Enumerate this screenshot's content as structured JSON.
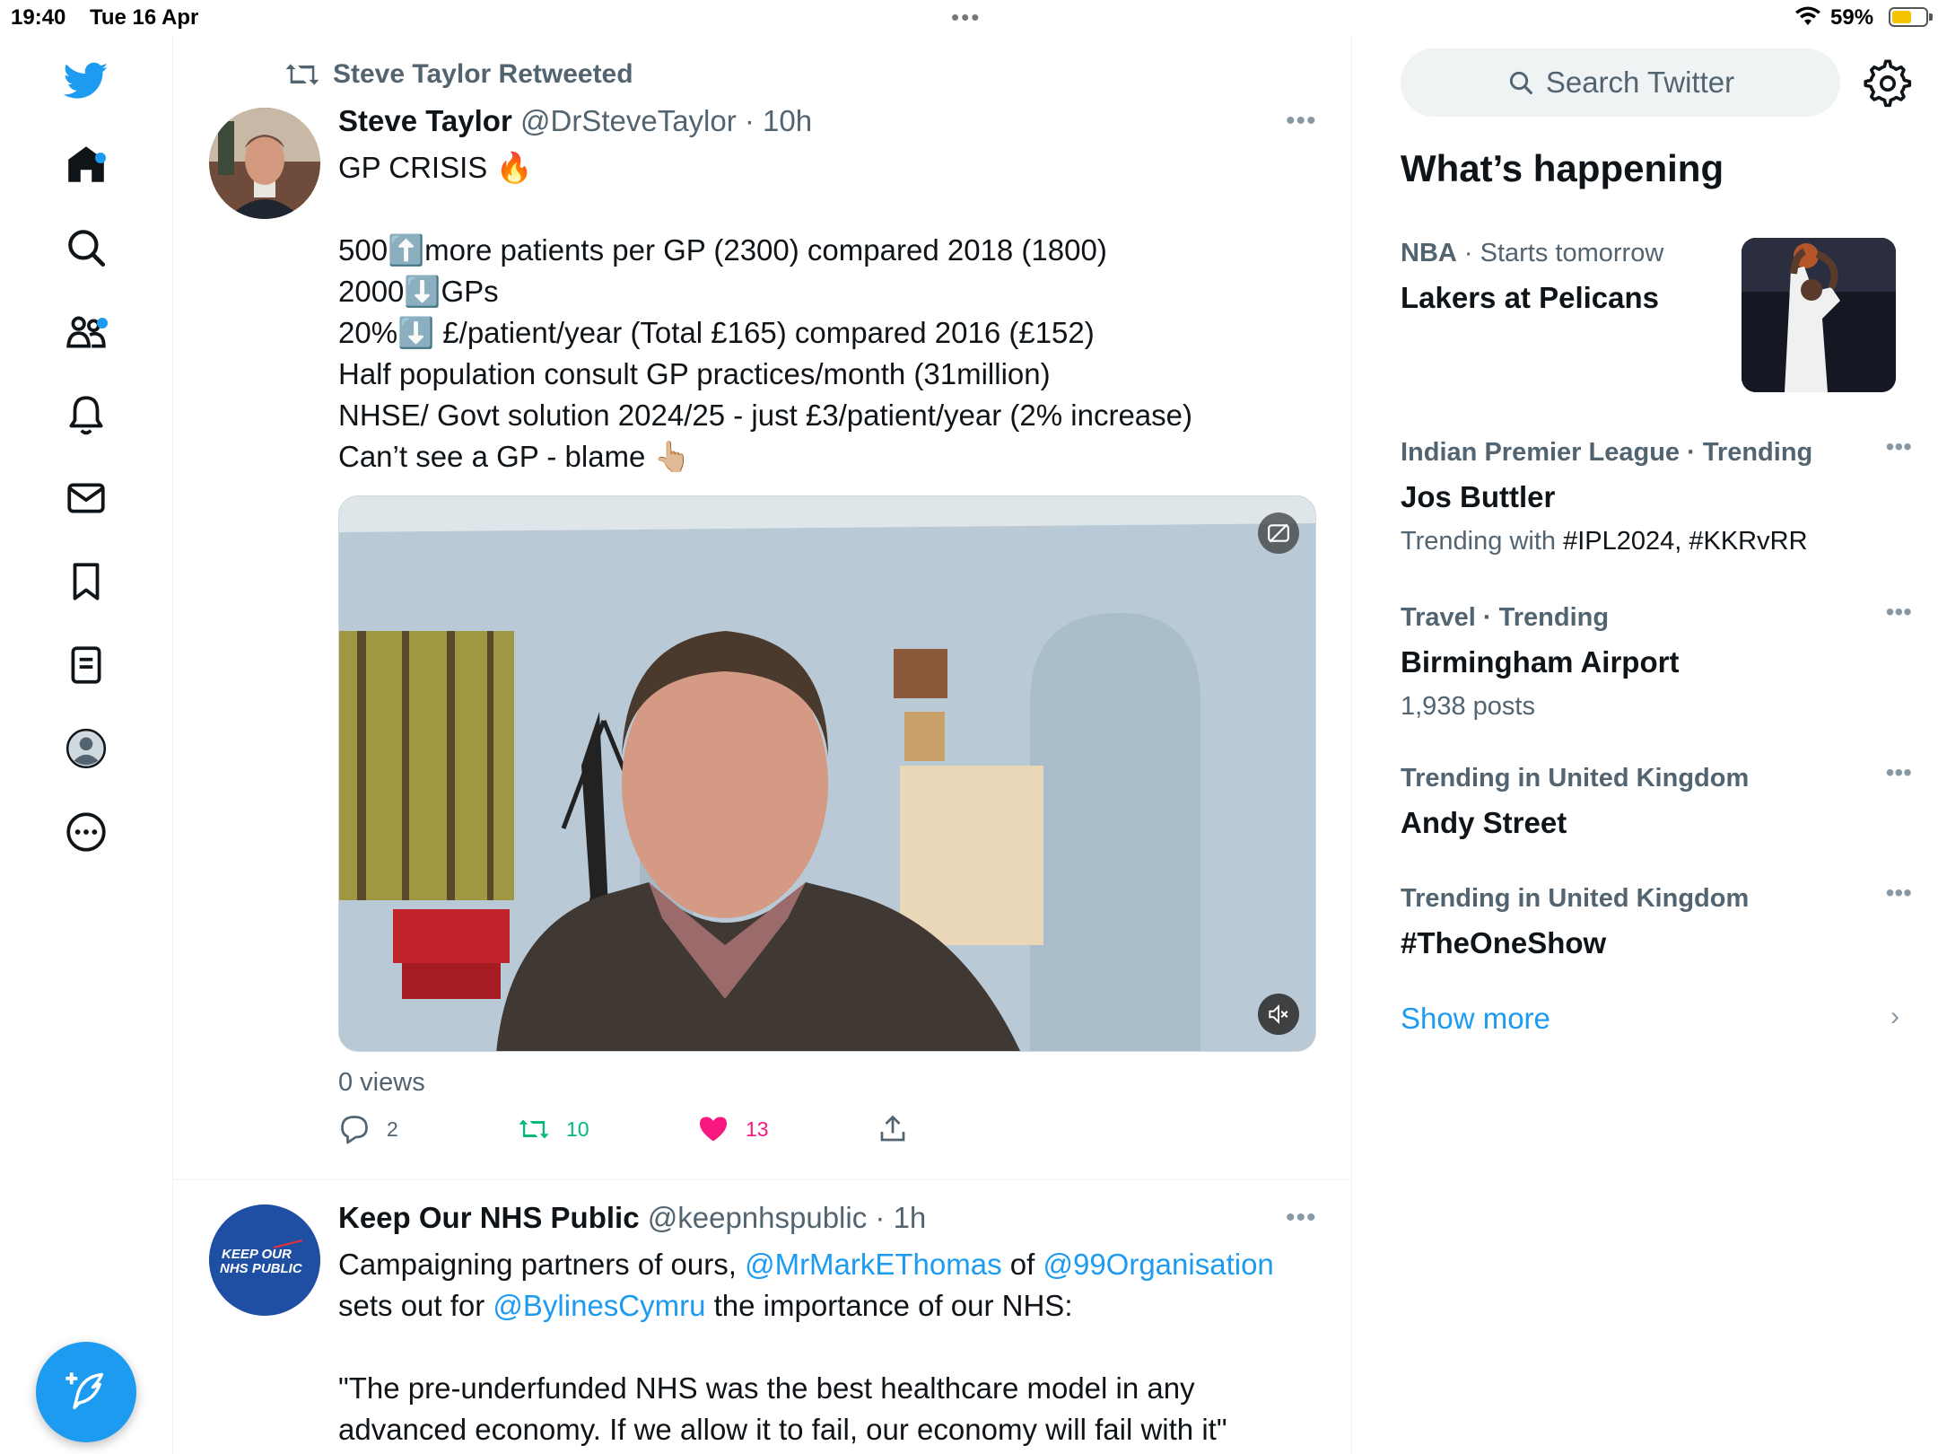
{
  "status_bar": {
    "time": "19:40",
    "date": "Tue 16 Apr",
    "battery": "59%",
    "battery_level": 0.59
  },
  "nav": {
    "icons": [
      "twitter-logo-icon",
      "home-icon",
      "search-icon",
      "communities-icon",
      "notifications-icon",
      "messages-icon",
      "bookmarks-icon",
      "lists-icon",
      "profile-icon",
      "more-icon"
    ],
    "compose_icon": "compose-tweet-icon"
  },
  "tweet1": {
    "retweeted_by": "Steve Taylor Retweeted",
    "name": "Steve Taylor",
    "handle": "@DrSteveTaylor",
    "time": "· 10h",
    "lines": [
      "GP CRISIS 🔥",
      "",
      "500⬆️more patients per GP (2300) compared 2018 (1800)",
      "2000⬇️GPs",
      "20%⬇️ £/patient/year (Total £165) compared 2016 (£152)",
      "Half population consult GP practices/month (31million)",
      "NHSE/ Govt solution 2024/25 - just £3/patient/year (2% increase)",
      "Can’t see a GP - blame 👆🏼"
    ],
    "views": "0 views",
    "replies": "2",
    "retweets": "10",
    "likes": "13"
  },
  "tweet2": {
    "name": "Keep Our NHS Public",
    "handle": "@keepnhspublic",
    "time": "· 1h",
    "avatar_text": "KEEP OUR NHS PUBLIC",
    "text": {
      "p1": "Campaigning partners of ours, ",
      "m1": "@MrMarkEThomas",
      "p2": " of ",
      "m2": "@99Organisation",
      "p3": "sets out for ",
      "m3": "@BylinesCymru",
      "p4": " the importance of our NHS:",
      "quote1": "\"The pre-underfunded NHS was the best healthcare model in any",
      "quote2": "advanced economy. If we allow it to fail, our economy will fail with it\""
    }
  },
  "sidebar": {
    "search_placeholder": "Search Twitter",
    "heading": "What’s happening",
    "trends": [
      {
        "category": "NBA",
        "extra": " · Starts tomorrow",
        "title": "Lakers at Pelicans"
      },
      {
        "category": "Indian Premier League · Trending",
        "title": "Jos Buttler",
        "sub_prefix": "Trending with ",
        "sub_tags": "#IPL2024, #KKRvRR"
      },
      {
        "category": "Travel · Trending",
        "title": "Birmingham Airport",
        "sub": "1,938 posts"
      },
      {
        "category": "Trending in United Kingdom",
        "title": "Andy Street"
      },
      {
        "category": "Trending in United Kingdom",
        "title": "#TheOneShow"
      }
    ],
    "show_more": "Show more"
  },
  "colors": {
    "accent": "#1d9bf0",
    "like": "#f91880",
    "retweet": "#00ba7c",
    "muted": "#536471"
  }
}
